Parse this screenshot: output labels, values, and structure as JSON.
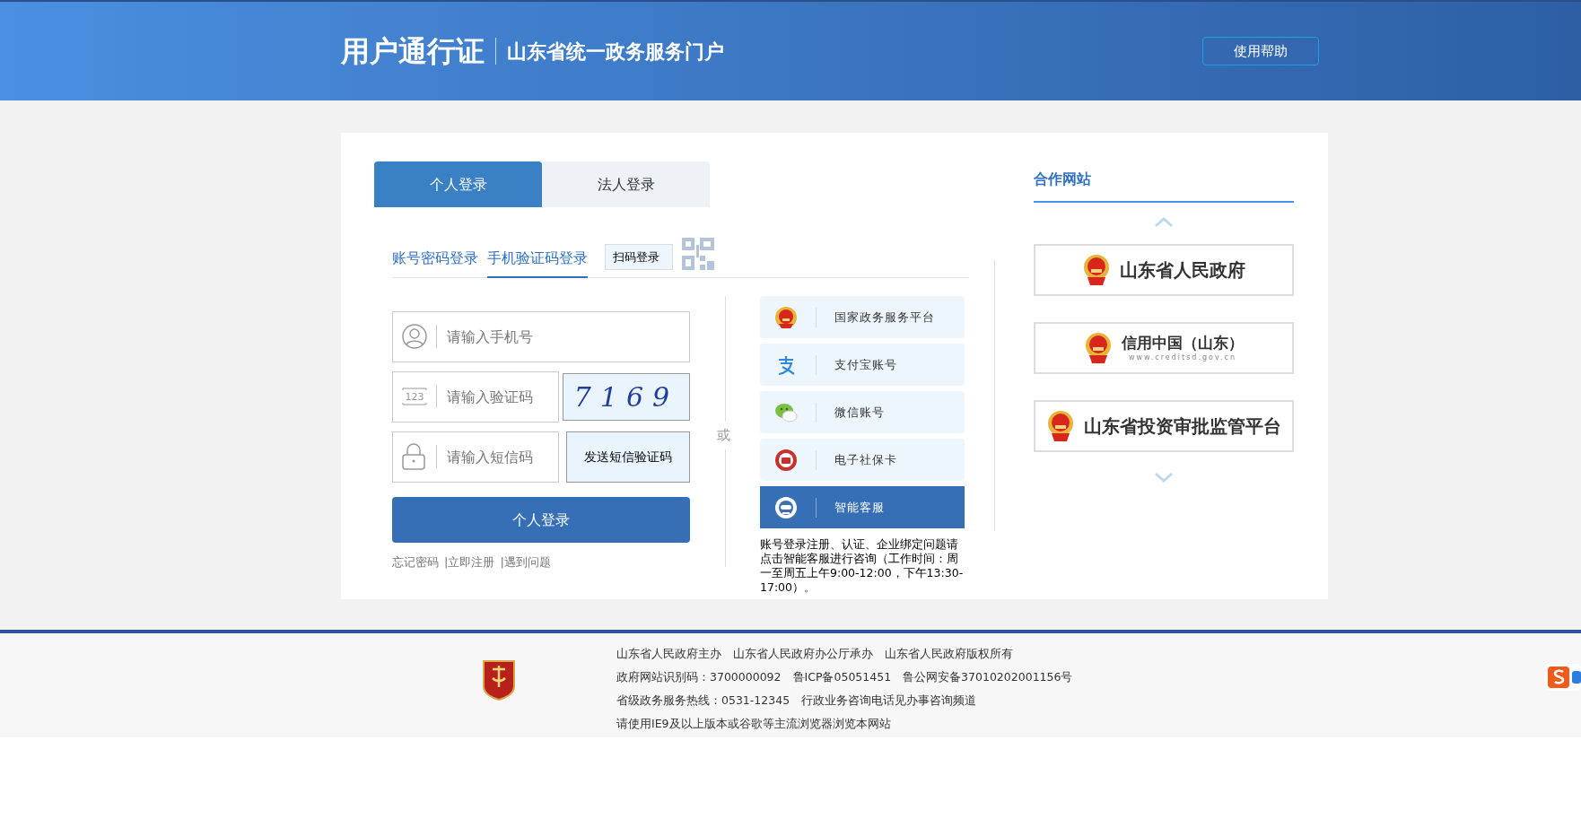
{
  "header": {
    "title": "用户通行证",
    "subtitle": "山东省统一政务服务门户",
    "help_button": "使用帮助"
  },
  "login_tabs": [
    {
      "label": "个人登录",
      "selected": true
    },
    {
      "label": "法人登录",
      "selected": false
    }
  ],
  "method_tabs": [
    {
      "label": "账号密码登录",
      "selected": false
    },
    {
      "label": "手机验证码登录",
      "selected": true
    },
    {
      "label": "扫码登录",
      "selected": false
    }
  ],
  "form": {
    "phone": {
      "placeholder": "请输入手机号"
    },
    "captcha": {
      "placeholder": "请输入验证码",
      "icon_text": "123"
    },
    "captcha_image": "7169",
    "sms": {
      "placeholder": "请输入短信码"
    },
    "send_sms_button": "发送短信验证码",
    "login_button": "个人登录",
    "links": [
      "忘记密码",
      "|立即注册",
      "|遇到问题"
    ]
  },
  "or_label": "或",
  "alt_logins": [
    {
      "kind": "emblem",
      "label": "国家政务服务平台",
      "selected": false
    },
    {
      "kind": "alipay",
      "label": "支付宝账号",
      "selected": false
    },
    {
      "kind": "wechat",
      "label": "微信账号",
      "selected": false
    },
    {
      "kind": "socialcard",
      "label": "电子社保卡",
      "selected": false
    },
    {
      "kind": "robot",
      "label": "智能客服",
      "selected": true
    }
  ],
  "service_note": "账号登录注册、认证、企业绑定问题请点击智能客服进行咨询（工作时间：周一至周五上午9:00-12:00，下午13:30-17:00）。",
  "partners": {
    "title": "合作网站",
    "items": [
      {
        "label": "山东省人民政府"
      },
      {
        "label": "信用中国（山东）",
        "sublabel": "www.creditsd.gov.cn"
      },
      {
        "label": "山东省投资审批监管平台"
      }
    ]
  },
  "footer": {
    "lines": [
      "山东省人民政府主办　山东省人民政府办公厅承办　山东省人民政府版权所有",
      "政府网站识别码：3700000092　鲁ICP备05051451　鲁公网安备37010202001156号",
      "省级政务服务热线：0531-12345　行政业务咨询电话见办事咨询频道",
      "请使用IE9及以上版本或谷歌等主流浏览器浏览本网站"
    ]
  }
}
